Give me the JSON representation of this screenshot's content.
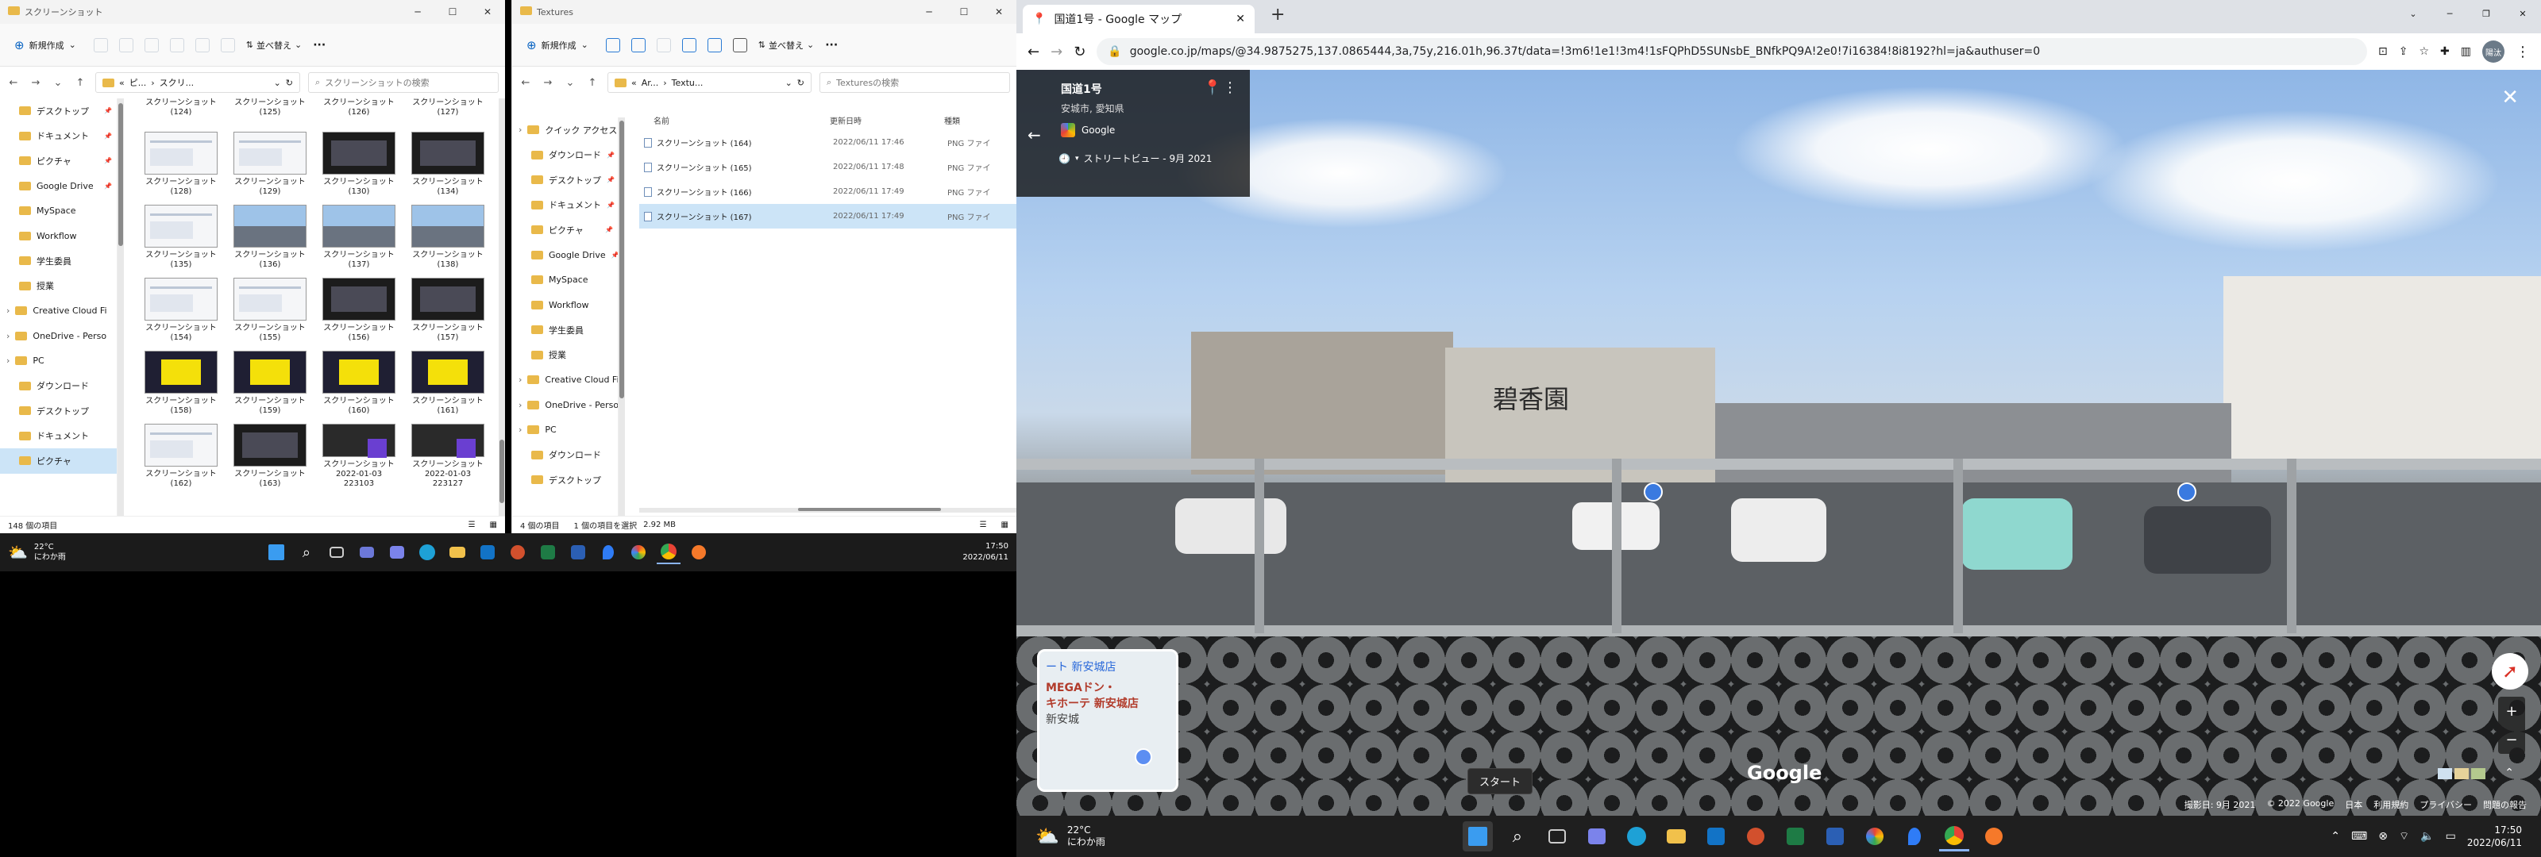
{
  "explorer1": {
    "title": "スクリーンショット",
    "toolbar": {
      "new_label": "新規作成",
      "sort_label": "並べ替え",
      "more": "···"
    },
    "address": {
      "prefix": "«",
      "part1": "ピ...",
      "part2": "スクリ...",
      "search_placeholder": "スクリーンショットの検索"
    },
    "sidebar": [
      {
        "label": "デスクトップ",
        "pinned": true
      },
      {
        "label": "ドキュメント",
        "pinned": true
      },
      {
        "label": "ピクチャ",
        "pinned": true
      },
      {
        "label": "Google Drive",
        "pinned": true
      },
      {
        "label": "MySpace",
        "pinned": false
      },
      {
        "label": "Workflow",
        "pinned": false
      },
      {
        "label": "学生委員",
        "pinned": false
      },
      {
        "label": "授業",
        "pinned": false
      },
      {
        "label": "Creative Cloud Fi",
        "pinned": false
      },
      {
        "label": "OneDrive - Perso",
        "pinned": false
      },
      {
        "label": "PC",
        "pinned": false
      },
      {
        "label": "ダウンロード",
        "pinned": false
      },
      {
        "label": "デスクトップ",
        "pinned": false
      },
      {
        "label": "ドキュメント",
        "pinned": false
      },
      {
        "label": "ピクチャ",
        "pinned": false
      }
    ],
    "top_row": [
      "スクリーンショット (124)",
      "スクリーンショット (125)",
      "スクリーンショット (126)",
      "スクリーンショット (127)"
    ],
    "files": [
      {
        "name": "スクリーンショット",
        "num": "(128)",
        "kind": "w"
      },
      {
        "name": "スクリーンショット",
        "num": "(129)",
        "kind": "w"
      },
      {
        "name": "スクリーンショット",
        "num": "(130)",
        "kind": "d"
      },
      {
        "name": "スクリーンショット",
        "num": "(134)",
        "kind": "d"
      },
      {
        "name": "スクリーンショット",
        "num": "(135)",
        "kind": "w"
      },
      {
        "name": "スクリーンショット",
        "num": "(136)",
        "kind": "s"
      },
      {
        "name": "スクリーンショット",
        "num": "(137)",
        "kind": "s"
      },
      {
        "name": "スクリーンショット",
        "num": "(138)",
        "kind": "s"
      },
      {
        "name": "スクリーンショット",
        "num": "(154)",
        "kind": "w"
      },
      {
        "name": "スクリーンショット",
        "num": "(155)",
        "kind": "w"
      },
      {
        "name": "スクリーンショット",
        "num": "(156)",
        "kind": "d"
      },
      {
        "name": "スクリーンショット",
        "num": "(157)",
        "kind": "d"
      },
      {
        "name": "スクリーンショット",
        "num": "(158)",
        "kind": "y"
      },
      {
        "name": "スクリーンショット",
        "num": "(159)",
        "kind": "y"
      },
      {
        "name": "スクリーンショット",
        "num": "(160)",
        "kind": "y"
      },
      {
        "name": "スクリーンショット",
        "num": "(161)",
        "kind": "y"
      },
      {
        "name": "スクリーンショット",
        "num": "(162)",
        "kind": "w"
      },
      {
        "name": "スクリーンショット",
        "num": "(163)",
        "kind": "d"
      },
      {
        "name": "スクリーンショット 2022-01-03",
        "num": "223103",
        "kind": "p"
      },
      {
        "name": "スクリーンショット 2022-01-03",
        "num": "223127",
        "kind": "p"
      }
    ],
    "status": "148 個の項目"
  },
  "explorer2": {
    "title": "Textures",
    "toolbar": {
      "new_label": "新規作成",
      "sort_label": "並べ替え",
      "more": "···"
    },
    "address": {
      "prefix": "«",
      "part1": "Ar...",
      "part2": "Textu...",
      "search_placeholder": "Texturesの検索"
    },
    "sidebar": [
      {
        "label": "クイック アクセス",
        "pinned": false
      },
      {
        "label": "ダウンロード",
        "pinned": true
      },
      {
        "label": "デスクトップ",
        "pinned": true
      },
      {
        "label": "ドキュメント",
        "pinned": true
      },
      {
        "label": "ピクチャ",
        "pinned": true
      },
      {
        "label": "Google Drive",
        "pinned": true
      },
      {
        "label": "MySpace",
        "pinned": false
      },
      {
        "label": "Workflow",
        "pinned": false
      },
      {
        "label": "学生委員",
        "pinned": false
      },
      {
        "label": "授業",
        "pinned": false
      },
      {
        "label": "Creative Cloud Fi",
        "pinned": false
      },
      {
        "label": "OneDrive - Perso",
        "pinned": false
      },
      {
        "label": "PC",
        "pinned": false
      },
      {
        "label": "ダウンロード",
        "pinned": false
      },
      {
        "label": "デスクトップ",
        "pinned": false
      }
    ],
    "columns": {
      "name": "名前",
      "date": "更新日時",
      "type": "種類"
    },
    "files": [
      {
        "name": "スクリーンショット (164)",
        "date": "2022/06/11 17:46",
        "type": "PNG ファイ"
      },
      {
        "name": "スクリーンショット (165)",
        "date": "2022/06/11 17:48",
        "type": "PNG ファイ"
      },
      {
        "name": "スクリーンショット (166)",
        "date": "2022/06/11 17:49",
        "type": "PNG ファイ"
      },
      {
        "name": "スクリーンショット (167)",
        "date": "2022/06/11 17:49",
        "type": "PNG ファイ"
      }
    ],
    "status": {
      "count": "4 個の項目",
      "selected": "1 個の項目を選択",
      "size": "2.92 MB"
    }
  },
  "taskbar_left": {
    "temp": "22°C",
    "weather": "にわか雨",
    "time": "17:50",
    "date": "2022/06/11"
  },
  "chrome": {
    "tab_title": "国道1号 - Google マップ",
    "new_tab": "+",
    "url": "google.co.jp/maps/@34.9875275,137.0865444,3a,75y,216.01h,96.37t/data=!3m6!1e1!3m4!1sFQPhD5SUNsbE_BNfkPQ9A!2e0!7i16384!8i8192?hl=ja&authuser=0",
    "profile": "陽汰"
  },
  "streetview": {
    "road": "国道1号",
    "city": "安城市, 愛知県",
    "provider": "Google",
    "date_label": "ストリートビュー - 9月 2021",
    "building_sign": "碧香園",
    "watermark": "Google",
    "minimap": {
      "line1": "ート 新安城店",
      "line2": "MEGAドン・",
      "line3": "キホーテ 新安城店",
      "line4": "新安城"
    },
    "footer": [
      "撮影日: 9月 2021",
      "© 2022 Google",
      "日本",
      "利用規約",
      "プライバシー",
      "問題の報告"
    ],
    "start_tooltip": "スタート"
  },
  "taskbar_right": {
    "temp": "22°C",
    "weather": "にわか雨",
    "time": "17:50",
    "date": "2022/06/11"
  }
}
